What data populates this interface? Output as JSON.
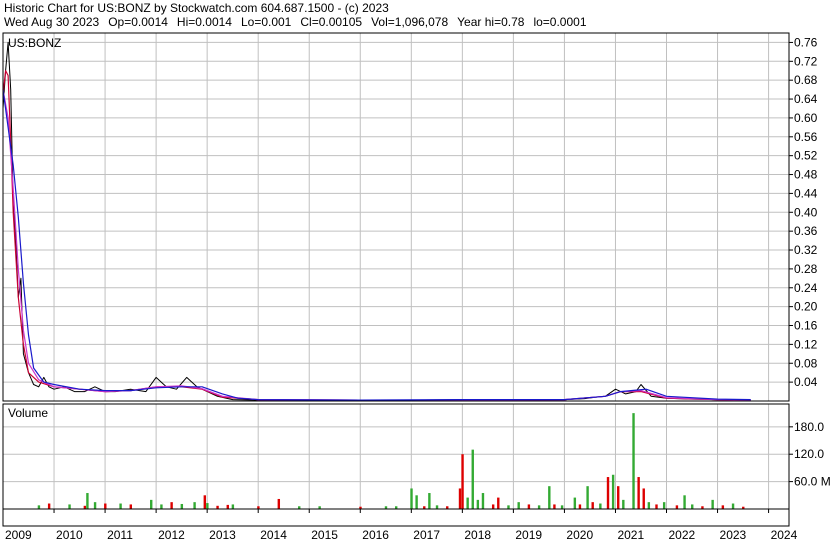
{
  "header": {
    "title": "Historic Chart for US:BONZ by Stockwatch.com 604.687.1500 - (c) 2023",
    "date": "Wed Aug 30 2023",
    "open": "Op=0.0014",
    "high": "Hi=0.0014",
    "low": "Lo=0.001",
    "close": "Cl=0.00105",
    "volume": "Vol=1,096,078",
    "year_high": "Year hi=0.78",
    "year_low": "lo=0.0001"
  },
  "colors": {
    "price": "#000000",
    "ma_short": "#cc0033",
    "ma_long": "#1a1acc",
    "ma_mid": "#cc33cc",
    "vol_up": "#33aa33",
    "vol_down": "#dd0000",
    "grid": "#c0c0c0"
  },
  "chart_data": [
    {
      "type": "line",
      "title": "US:BONZ",
      "y_ticks": [
        "0.76",
        "0.72",
        "0.68",
        "0.64",
        "0.60",
        "0.56",
        "0.52",
        "0.48",
        "0.44",
        "0.40",
        "0.36",
        "0.32",
        "0.28",
        "0.24",
        "0.20",
        "0.16",
        "0.12",
        "0.08",
        "0.04"
      ],
      "ylim": [
        0,
        0.78
      ],
      "x_ticks": [
        "2009",
        "2010",
        "2011",
        "2012",
        "2013",
        "2014",
        "2015",
        "2016",
        "2017",
        "2018",
        "2019",
        "2020",
        "2021",
        "2022",
        "2023",
        "2024"
      ],
      "xlim": [
        2009.0,
        2024.4
      ],
      "grid": true,
      "series": [
        {
          "key": "price",
          "x": [
            2009.0,
            2009.05,
            2009.1,
            2009.15,
            2009.2,
            2009.25,
            2009.3,
            2009.35,
            2009.4,
            2009.5,
            2009.6,
            2009.7,
            2009.8,
            2009.9,
            2010.0,
            2010.2,
            2010.4,
            2010.6,
            2010.8,
            2011.0,
            2011.2,
            2011.5,
            2011.8,
            2012.0,
            2012.2,
            2012.4,
            2012.6,
            2012.8,
            2013.0,
            2013.2,
            2013.5,
            2014.0,
            2015.0,
            2016.0,
            2017.0,
            2018.0,
            2019.0,
            2020.0,
            2020.4,
            2020.6,
            2020.8,
            2021.0,
            2021.2,
            2021.4,
            2021.5,
            2021.7,
            2022.0,
            2022.5,
            2023.0,
            2023.65
          ],
          "y": [
            0.62,
            0.7,
            0.76,
            0.66,
            0.42,
            0.34,
            0.22,
            0.26,
            0.1,
            0.06,
            0.035,
            0.03,
            0.05,
            0.03,
            0.025,
            0.03,
            0.02,
            0.02,
            0.03,
            0.02,
            0.02,
            0.025,
            0.02,
            0.05,
            0.03,
            0.025,
            0.05,
            0.03,
            0.02,
            0.01,
            0.003,
            0.002,
            0.002,
            0.002,
            0.002,
            0.003,
            0.002,
            0.003,
            0.005,
            0.008,
            0.01,
            0.025,
            0.015,
            0.02,
            0.035,
            0.01,
            0.006,
            0.004,
            0.003,
            0.002
          ]
        },
        {
          "key": "ma_short",
          "x": [
            2009.0,
            2009.05,
            2009.1,
            2009.15,
            2009.2,
            2009.3,
            2009.4,
            2009.5,
            2009.7,
            2010.0,
            2010.5,
            2011.0,
            2011.5,
            2012.0,
            2012.5,
            2012.9,
            2013.3,
            2014.0,
            2016.0,
            2018.0,
            2020.0,
            2020.8,
            2021.1,
            2021.5,
            2022.0,
            2023.0,
            2023.65
          ],
          "y": [
            0.65,
            0.7,
            0.69,
            0.55,
            0.4,
            0.22,
            0.12,
            0.06,
            0.04,
            0.03,
            0.025,
            0.02,
            0.022,
            0.03,
            0.03,
            0.025,
            0.008,
            0.003,
            0.002,
            0.002,
            0.003,
            0.01,
            0.02,
            0.02,
            0.006,
            0.003,
            0.002
          ]
        },
        {
          "key": "ma_mid",
          "x": [
            2009.0,
            2009.1,
            2009.2,
            2009.3,
            2009.4,
            2009.5,
            2009.7,
            2010.0,
            2010.5,
            2011.0,
            2011.5,
            2012.0,
            2012.5,
            2012.9,
            2013.3,
            2014.0,
            2016.0,
            2018.0,
            2020.0,
            2020.8,
            2021.1,
            2021.5,
            2022.0,
            2023.0,
            2023.65
          ],
          "y": [
            0.66,
            0.6,
            0.45,
            0.28,
            0.15,
            0.08,
            0.045,
            0.03,
            0.025,
            0.02,
            0.022,
            0.03,
            0.032,
            0.026,
            0.01,
            0.003,
            0.002,
            0.002,
            0.003,
            0.01,
            0.02,
            0.022,
            0.007,
            0.003,
            0.002
          ]
        },
        {
          "key": "ma_long",
          "x": [
            2009.0,
            2009.2,
            2009.3,
            2009.4,
            2009.5,
            2009.6,
            2009.8,
            2010.0,
            2010.5,
            2011.0,
            2011.5,
            2012.0,
            2012.5,
            2012.9,
            2013.3,
            2013.6,
            2014.0,
            2016.0,
            2018.0,
            2020.0,
            2020.8,
            2021.1,
            2021.6,
            2022.0,
            2023.0,
            2023.65
          ],
          "y": [
            0.66,
            0.5,
            0.39,
            0.25,
            0.14,
            0.07,
            0.04,
            0.035,
            0.025,
            0.022,
            0.022,
            0.028,
            0.03,
            0.03,
            0.015,
            0.006,
            0.003,
            0.002,
            0.003,
            0.003,
            0.01,
            0.02,
            0.025,
            0.01,
            0.004,
            0.003
          ]
        }
      ]
    },
    {
      "type": "bar",
      "title": "Volume",
      "y_ticks": [
        "180.0",
        "120.0",
        "60.0 M"
      ],
      "ylim": [
        0,
        230
      ],
      "volume_bars": [
        [
          2009.7,
          8,
          "up"
        ],
        [
          2009.9,
          12,
          "down"
        ],
        [
          2010.3,
          10,
          "up"
        ],
        [
          2010.6,
          7,
          "down"
        ],
        [
          2010.65,
          35,
          "up"
        ],
        [
          2010.8,
          15,
          "up"
        ],
        [
          2011.0,
          12,
          "down"
        ],
        [
          2011.3,
          12,
          "up"
        ],
        [
          2011.5,
          10,
          "down"
        ],
        [
          2011.9,
          20,
          "up"
        ],
        [
          2012.1,
          10,
          "up"
        ],
        [
          2012.3,
          15,
          "down"
        ],
        [
          2012.5,
          11,
          "up"
        ],
        [
          2012.75,
          15,
          "up"
        ],
        [
          2012.95,
          30,
          "down"
        ],
        [
          2013.0,
          13,
          "up"
        ],
        [
          2013.2,
          7,
          "down"
        ],
        [
          2013.4,
          9,
          "down"
        ],
        [
          2013.5,
          10,
          "up"
        ],
        [
          2014.0,
          6,
          "down"
        ],
        [
          2014.4,
          22,
          "down"
        ],
        [
          2014.8,
          6,
          "up"
        ],
        [
          2015.2,
          6,
          "up"
        ],
        [
          2016.0,
          5,
          "down"
        ],
        [
          2016.5,
          6,
          "up"
        ],
        [
          2016.7,
          6,
          "up"
        ],
        [
          2017.0,
          45,
          "up"
        ],
        [
          2017.1,
          30,
          "up"
        ],
        [
          2017.25,
          6,
          "down"
        ],
        [
          2017.35,
          35,
          "up"
        ],
        [
          2017.5,
          8,
          "up"
        ],
        [
          2017.7,
          6,
          "down"
        ],
        [
          2017.95,
          45,
          "down"
        ],
        [
          2018.0,
          120,
          "down"
        ],
        [
          2018.1,
          25,
          "up"
        ],
        [
          2018.2,
          130,
          "up"
        ],
        [
          2018.3,
          20,
          "up"
        ],
        [
          2018.4,
          35,
          "up"
        ],
        [
          2018.6,
          10,
          "down"
        ],
        [
          2018.7,
          25,
          "down"
        ],
        [
          2018.9,
          8,
          "up"
        ],
        [
          2019.1,
          15,
          "up"
        ],
        [
          2019.3,
          10,
          "down"
        ],
        [
          2019.5,
          8,
          "up"
        ],
        [
          2019.7,
          50,
          "up"
        ],
        [
          2019.8,
          10,
          "down"
        ],
        [
          2019.95,
          8,
          "up"
        ],
        [
          2020.2,
          25,
          "up"
        ],
        [
          2020.3,
          10,
          "down"
        ],
        [
          2020.45,
          50,
          "up"
        ],
        [
          2020.55,
          15,
          "down"
        ],
        [
          2020.7,
          12,
          "up"
        ],
        [
          2020.85,
          70,
          "down"
        ],
        [
          2020.95,
          75,
          "up"
        ],
        [
          2021.05,
          50,
          "down"
        ],
        [
          2021.15,
          20,
          "up"
        ],
        [
          2021.35,
          210,
          "up"
        ],
        [
          2021.45,
          70,
          "down"
        ],
        [
          2021.55,
          45,
          "down"
        ],
        [
          2021.65,
          15,
          "up"
        ],
        [
          2021.8,
          10,
          "down"
        ],
        [
          2021.95,
          15,
          "up"
        ],
        [
          2022.2,
          8,
          "down"
        ],
        [
          2022.35,
          30,
          "up"
        ],
        [
          2022.5,
          10,
          "up"
        ],
        [
          2022.7,
          6,
          "down"
        ],
        [
          2022.9,
          20,
          "up"
        ],
        [
          2023.1,
          8,
          "down"
        ],
        [
          2023.3,
          12,
          "up"
        ],
        [
          2023.5,
          5,
          "down"
        ]
      ]
    }
  ]
}
